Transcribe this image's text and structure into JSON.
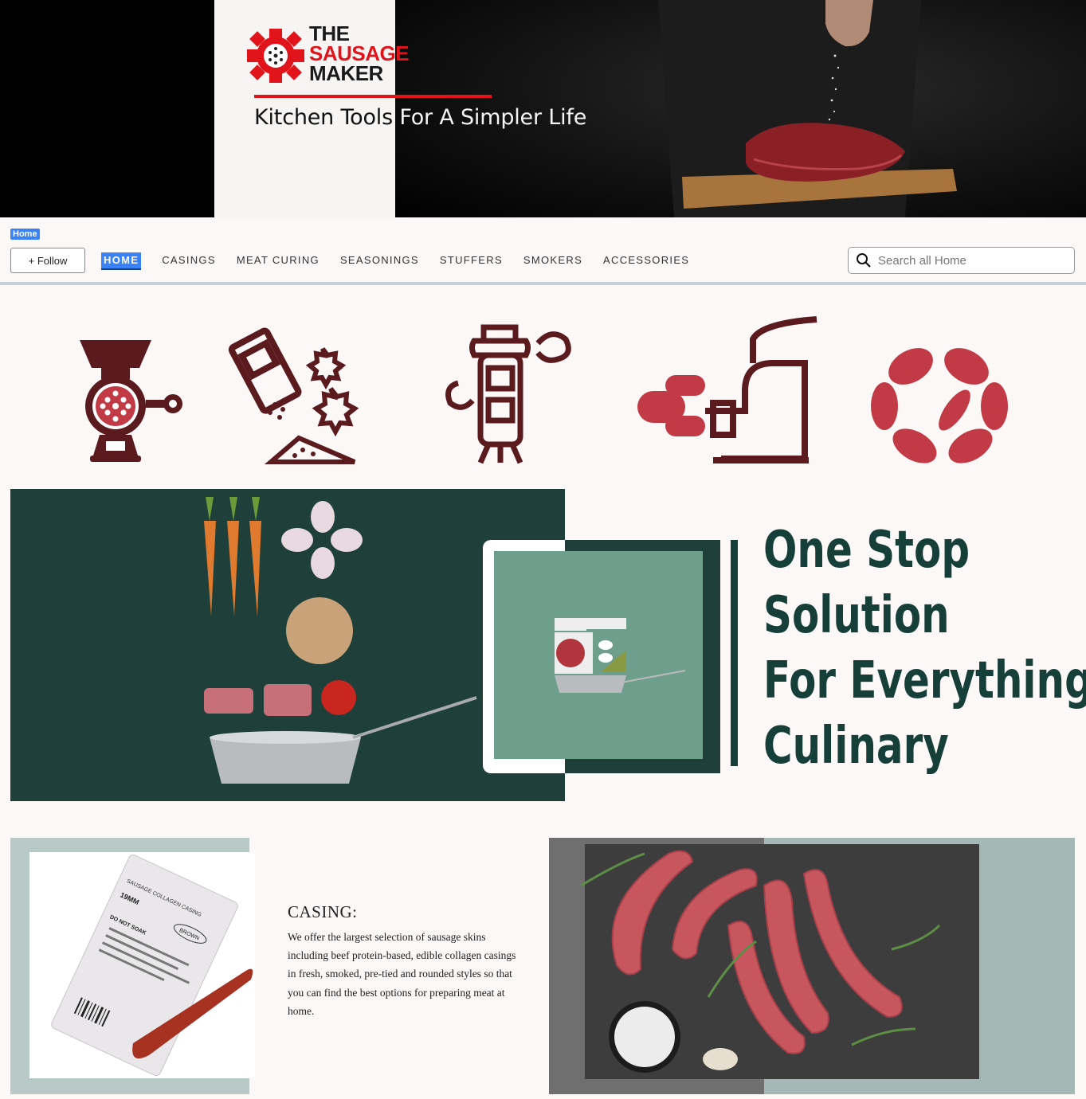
{
  "hero": {
    "logo_line1": "THE",
    "logo_line2": "SAUSAGE",
    "logo_line3": "MAKER",
    "tagline_dark": "Kitchen Tools",
    "tagline_light": " For A Simpler Life",
    "brand_red": "#e1141b"
  },
  "breadcrumb": {
    "label": "Home"
  },
  "follow": {
    "label": "+ Follow"
  },
  "nav": {
    "items": [
      {
        "label": "HOME",
        "active": true
      },
      {
        "label": "CASINGS"
      },
      {
        "label": "MEAT CURING"
      },
      {
        "label": "SEASONINGS"
      },
      {
        "label": "STUFFERS"
      },
      {
        "label": "SMOKERS"
      },
      {
        "label": "ACCESSORIES"
      }
    ],
    "accent": "#3b82f6"
  },
  "search": {
    "placeholder": "Search all Home"
  },
  "icons": [
    "meat-grinder-icon",
    "seasoning-shaker-icon",
    "smoker-icon",
    "sausage-stuffer-icon",
    "sausage-link-icon"
  ],
  "onestop": {
    "line1": "One Stop",
    "line2": "Solution",
    "line3": "For Everything",
    "line4": "Culinary",
    "color": "#163f3a"
  },
  "casing": {
    "title": "CASING:",
    "body": "We offer the largest selection of sausage skins including beef protein-based, edible collagen casings in fresh, smoked, pre-tied and rounded styles so that you can find the best options for preparing meat at home.",
    "package_line1": "SAUSAGE COLLAGEN CASING",
    "package_line2": "19MM",
    "package_line3": "BROWN",
    "package_line4": "DO NOT SOAK"
  }
}
